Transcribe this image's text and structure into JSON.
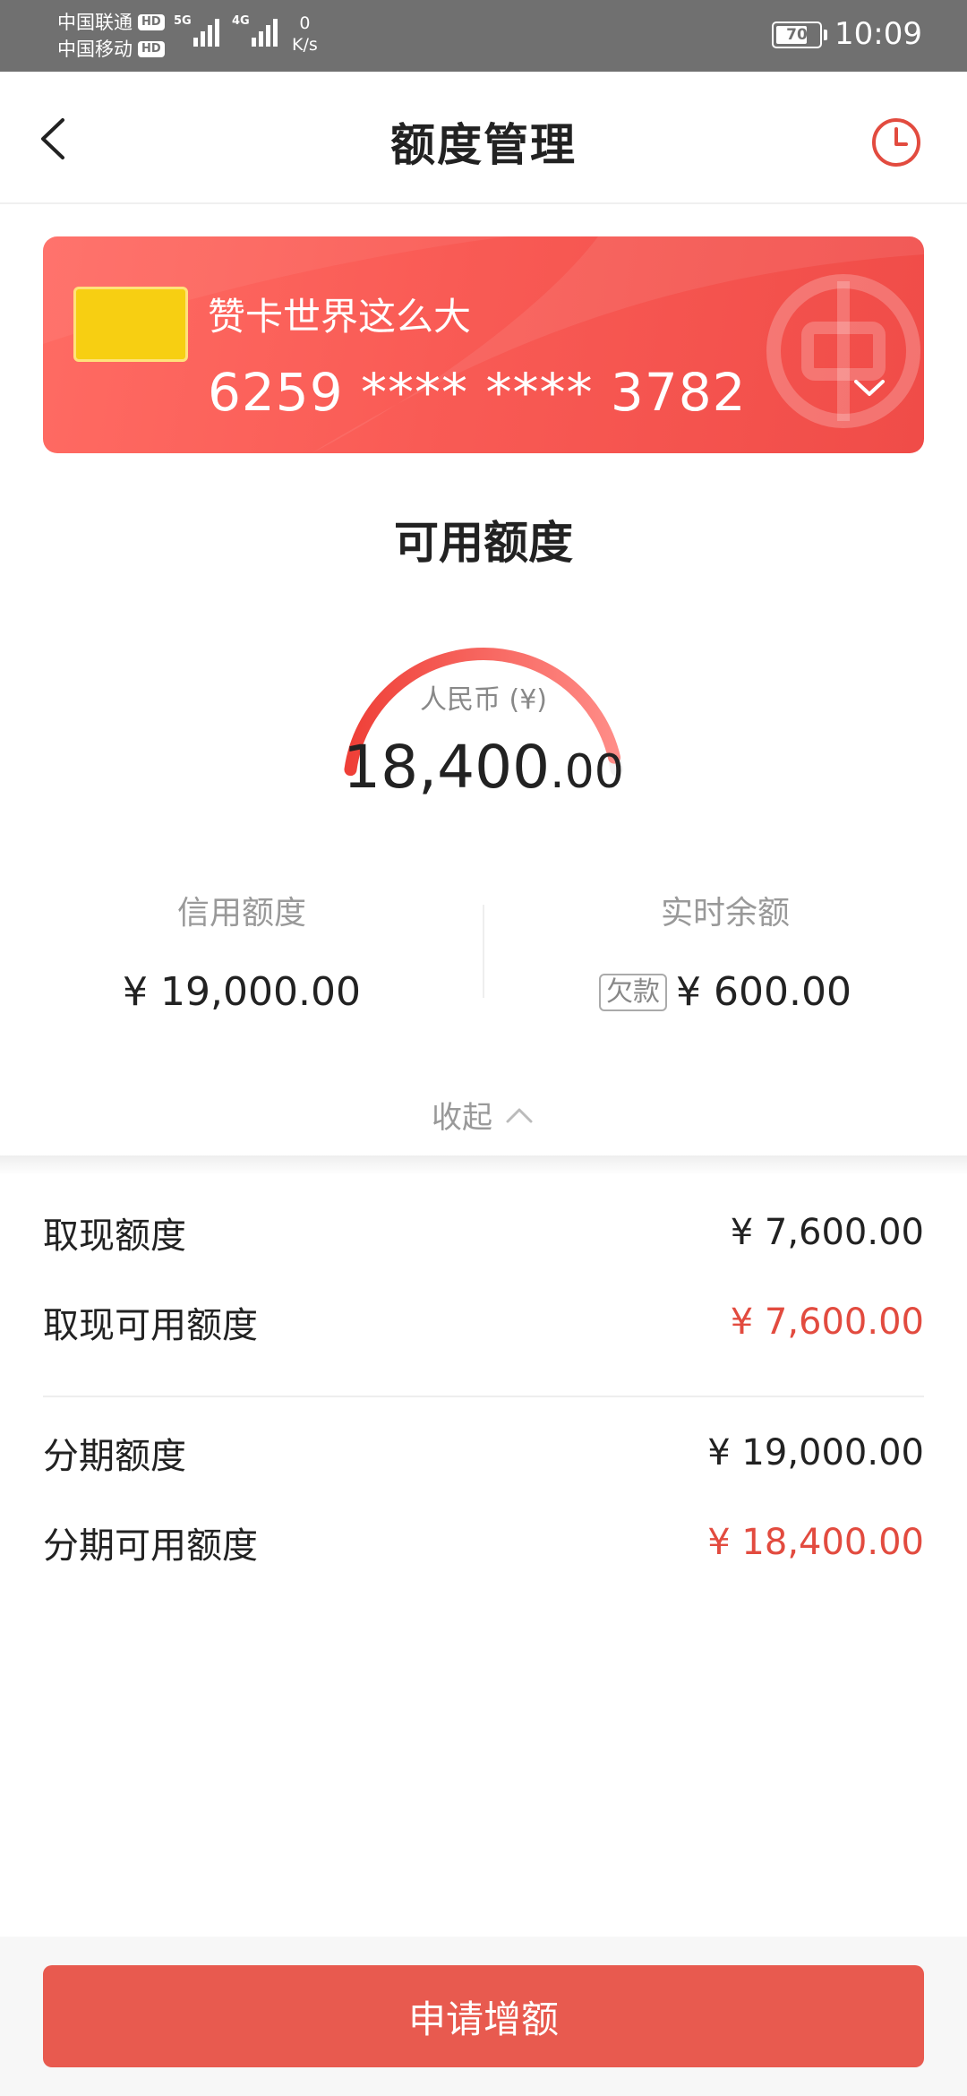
{
  "status_bar": {
    "carrier1": "中国联通",
    "carrier2": "中国移动",
    "hd": "HD",
    "net1": "5G",
    "net2": "4G",
    "speed_value": "0",
    "speed_unit": "K/s",
    "battery": "70",
    "time": "10:09"
  },
  "header": {
    "title": "额度管理",
    "back_icon": "chevron-left-icon",
    "history_icon": "clock-icon"
  },
  "card": {
    "name": "赞卡世界这么大",
    "number": "6259 **** **** 3782",
    "dropdown_icon": "chevron-down-icon",
    "chip_color": "#f7cf12"
  },
  "available": {
    "title": "可用额度",
    "currency": "人民币 (¥)",
    "amount_int": "18,400",
    "amount_dec": ".00",
    "used_fraction": 0.968
  },
  "summary": {
    "credit_limit_label": "信用额度",
    "credit_limit_value": "¥ 19,000.00",
    "balance_label": "实时余额",
    "balance_badge": "欠款",
    "balance_value": "¥ 600.00"
  },
  "collapse_label": "收起",
  "details": [
    {
      "label": "取现额度",
      "value": "¥ 7,600.00"
    },
    {
      "label": "取现可用额度",
      "value": "¥ 7,600.00"
    },
    {
      "label": "分期额度",
      "value": "¥ 19,000.00"
    },
    {
      "label": "分期可用额度",
      "value": "¥ 18,400.00"
    }
  ],
  "apply_button": "申请增额",
  "colors": {
    "accent": "#e85a4f",
    "value_red": "#e24b3f",
    "card_red": "#f95b55"
  }
}
